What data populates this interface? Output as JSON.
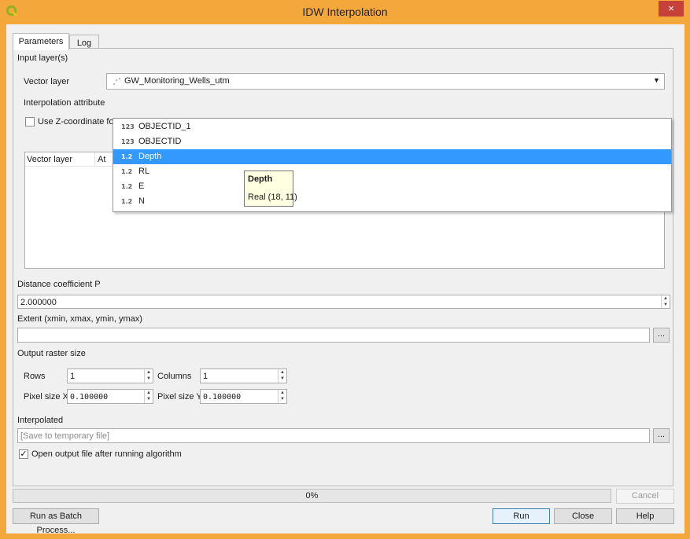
{
  "window": {
    "title": "IDW Interpolation",
    "close_symbol": "×"
  },
  "tabs": [
    {
      "label": "Parameters"
    },
    {
      "label": "Log"
    }
  ],
  "input_layers": {
    "section_label": "Input layer(s)",
    "vector_layer_label": "Vector layer",
    "vector_layer_value": "GW_Monitoring_Wells_utm",
    "interpolation_attribute_label": "Interpolation attribute",
    "use_z_label": "Use Z-coordinate fo",
    "table_col_vector_layer": "Vector layer",
    "table_col_attribute": "At"
  },
  "attribute_dropdown": {
    "items": [
      {
        "type": "123",
        "name": "OBJECTID_1",
        "selected": false
      },
      {
        "type": "123",
        "name": "OBJECTID",
        "selected": false
      },
      {
        "type": "1.2",
        "name": "Depth",
        "selected": true
      },
      {
        "type": "1.2",
        "name": "RL",
        "selected": false
      },
      {
        "type": "1.2",
        "name": "E",
        "selected": false
      },
      {
        "type": "1.2",
        "name": "N",
        "selected": false
      }
    ]
  },
  "tooltip": {
    "title": "Depth",
    "detail": "Real (18, 11)"
  },
  "distance_coefficient": {
    "label": "Distance coefficient P",
    "value": "2.000000"
  },
  "extent": {
    "label": "Extent (xmin, xmax, ymin, ymax)",
    "value": "",
    "browse": "..."
  },
  "output_raster": {
    "label": "Output raster size",
    "rows_label": "Rows",
    "rows_value": "1",
    "columns_label": "Columns",
    "columns_value": "1",
    "pixel_x_label": "Pixel size X",
    "pixel_x_value": "0.100000",
    "pixel_y_label": "Pixel size Y",
    "pixel_y_value": "0.100000"
  },
  "interpolated": {
    "label": "Interpolated",
    "placeholder": "[Save to temporary file]",
    "browse": "..."
  },
  "open_output": {
    "label": "Open output file after running algorithm",
    "checked": true
  },
  "progress": {
    "text": "0%",
    "percent": 0
  },
  "buttons": {
    "cancel": "Cancel",
    "batch": "Run as Batch Process...",
    "run": "Run",
    "close": "Close",
    "help": "Help"
  },
  "colors": {
    "frame": "#f4a83c",
    "close": "#c7413b",
    "selection": "#3399ff",
    "tooltip_bg": "#ffffe1"
  }
}
